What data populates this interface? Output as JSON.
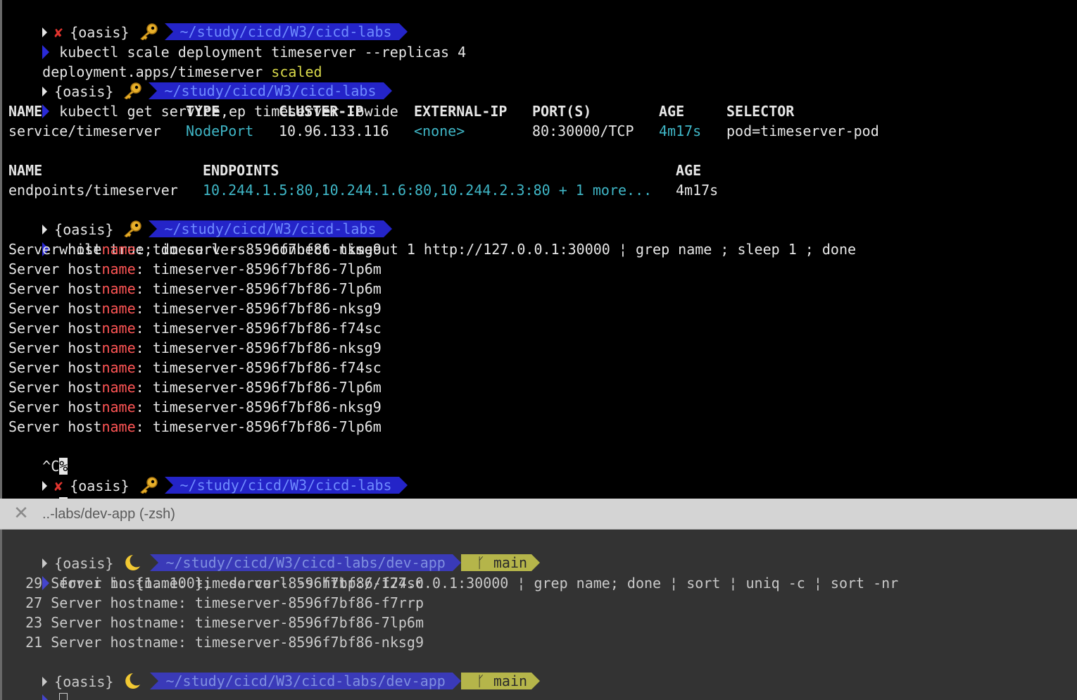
{
  "top_pane": {
    "prompt_context": "{oasis}",
    "prompt_path": "~/study/cicd/W3/cicd-labs",
    "error_mark": "✘",
    "cmd1": "kubectl scale deployment timeserver --replicas 4",
    "cmd1_out_prefix": "deployment.apps/timeserver ",
    "cmd1_out_status": "scaled",
    "cmd2": "kubectl get service,ep timeserver -owide",
    "svc_headers": [
      "NAME",
      "TYPE",
      "CLUSTER-IP",
      "EXTERNAL-IP",
      "PORT(S)",
      "AGE",
      "SELECTOR"
    ],
    "svc_row": [
      "service/timeserver",
      "NodePort",
      "10.96.133.116",
      "<none>",
      "80:30000/TCP",
      "4m17s",
      "pod=timeserver-pod"
    ],
    "ep_headers": [
      "NAME",
      "ENDPOINTS",
      "AGE"
    ],
    "ep_row": [
      "endpoints/timeserver",
      "10.244.1.5:80,10.244.1.6:80,10.244.2.3:80 + 1 more...",
      "4m17s"
    ],
    "cmd3": "while true; do curl -s --connect-timeout 1 http://127.0.0.1:30000 ¦ grep name ; sleep 1 ; done",
    "curl_output": [
      {
        "pre": "Server host",
        "hl": "name",
        "post": ": timeserver-8596f7bf86-nksg9"
      },
      {
        "pre": "Server host",
        "hl": "name",
        "post": ": timeserver-8596f7bf86-7lp6m"
      },
      {
        "pre": "Server host",
        "hl": "name",
        "post": ": timeserver-8596f7bf86-7lp6m"
      },
      {
        "pre": "Server host",
        "hl": "name",
        "post": ": timeserver-8596f7bf86-nksg9"
      },
      {
        "pre": "Server host",
        "hl": "name",
        "post": ": timeserver-8596f7bf86-f74sc"
      },
      {
        "pre": "Server host",
        "hl": "name",
        "post": ": timeserver-8596f7bf86-nksg9"
      },
      {
        "pre": "Server host",
        "hl": "name",
        "post": ": timeserver-8596f7bf86-f74sc"
      },
      {
        "pre": "Server host",
        "hl": "name",
        "post": ": timeserver-8596f7bf86-7lp6m"
      },
      {
        "pre": "Server host",
        "hl": "name",
        "post": ": timeserver-8596f7bf86-nksg9"
      },
      {
        "pre": "Server host",
        "hl": "name",
        "post": ": timeserver-8596f7bf86-7lp6m"
      }
    ],
    "interrupt_text": "^C",
    "interrupt_mark": "%"
  },
  "tab": {
    "close_glyph": "✕",
    "title": "..-labs/dev-app (-zsh)"
  },
  "bottom_pane": {
    "prompt_context": "{oasis}",
    "prompt_path": "~/study/cicd/W3/cicd-labs/dev-app",
    "git_glyph": "ᚴ",
    "git_branch": "main",
    "cmd": "for i in {1..100};  do curl -s http://127.0.0.1:30000 ¦ grep name; done ¦ sort ¦ uniq -c ¦ sort -nr",
    "counts": [
      "  29 Server hostname: timeserver-8596f7bf86-f74sc",
      "  27 Server hostname: timeserver-8596f7bf86-f7rrp",
      "  23 Server hostname: timeserver-8596f7bf86-7lp6m",
      "  21 Server hostname: timeserver-8596f7bf86-nksg9"
    ]
  },
  "colors": {
    "prompt_arrow": "#2a2ad6",
    "path_bg": "#2424c8",
    "error": "#e0342e",
    "highlight": "#ff5555",
    "cyan": "#3fb6c6",
    "yellow": "#d9d94a"
  }
}
